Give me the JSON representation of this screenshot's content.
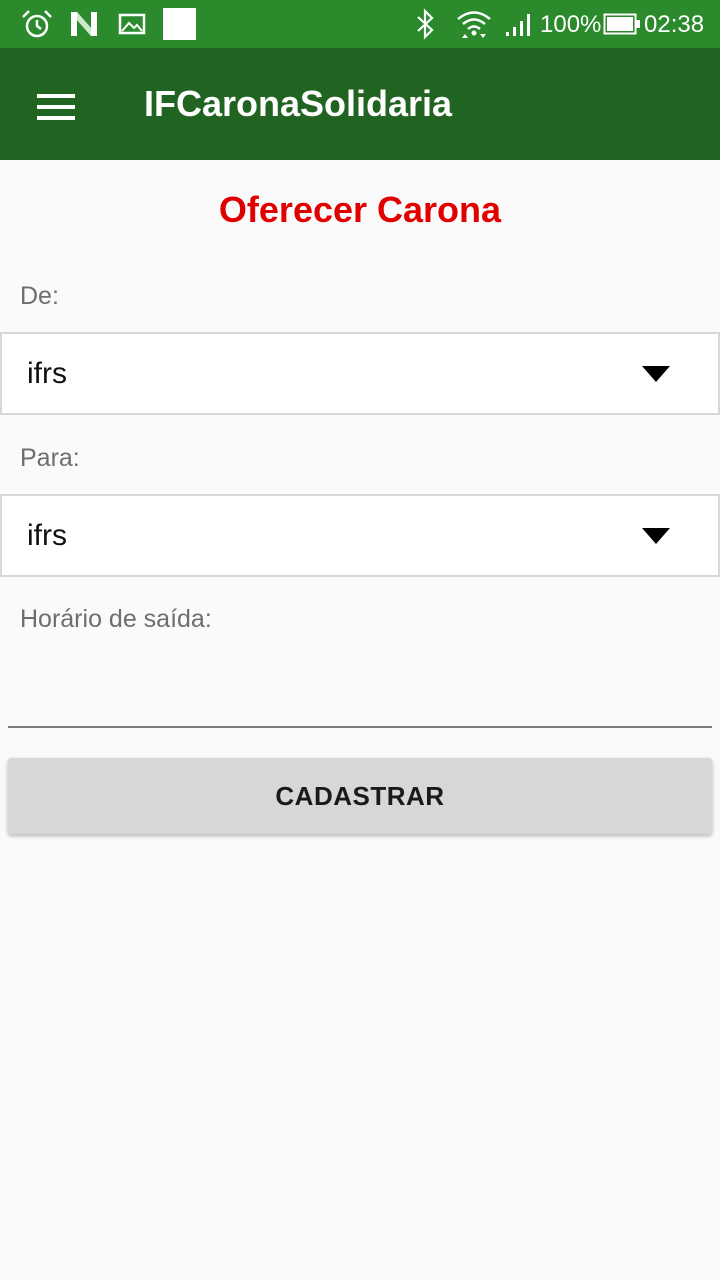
{
  "status_bar": {
    "background": "#2a8a2c",
    "left_icons": [
      "alarm-icon",
      "n-notification-icon",
      "image-notification-icon",
      "blank-notification-icon"
    ],
    "right_icons": [
      "bluetooth-icon",
      "wifi-icon",
      "signal-icon",
      "battery-icon"
    ],
    "battery_percent": "100%",
    "time": "02:38"
  },
  "app_bar": {
    "background": "#216421",
    "menu_icon": "hamburger-menu-icon",
    "title": "IFCaronaSolidaria"
  },
  "form": {
    "title": "Oferecer Carona",
    "title_color": "#e00000",
    "from_label": "De:",
    "from_value": "ifrs",
    "to_label": "Para:",
    "to_value": "ifrs",
    "departure_label": "Horário de saída:",
    "departure_value": "",
    "submit_label": "CADASTRAR"
  }
}
